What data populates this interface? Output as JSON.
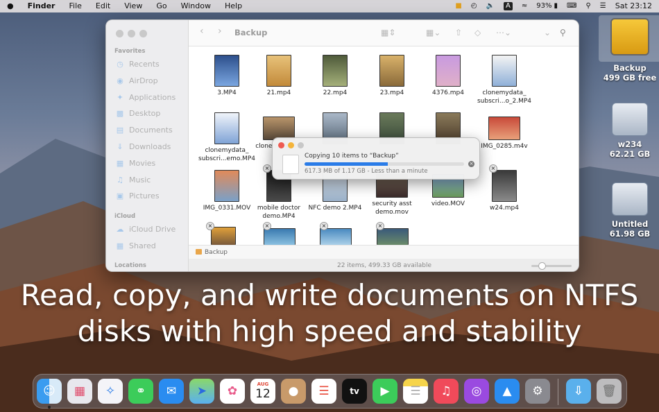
{
  "menubar": {
    "apple": "",
    "app": "Finder",
    "menus": [
      "File",
      "Edit",
      "View",
      "Go",
      "Window",
      "Help"
    ],
    "battery": "93%",
    "input_source": "A",
    "clock": "Sat 23:12"
  },
  "finder": {
    "title": "Backup",
    "sidebar": {
      "favorites_header": "Favorites",
      "favorites": [
        "Recents",
        "AirDrop",
        "Applications",
        "Desktop",
        "Documents",
        "Downloads",
        "Movies",
        "Music",
        "Pictures"
      ],
      "icloud_header": "iCloud",
      "icloud": [
        "iCloud Drive",
        "Shared"
      ],
      "locations_header": "Locations"
    },
    "files": [
      "3.MP4",
      "21.mp4",
      "22.mp4",
      "23.mp4",
      "4376.mp4",
      "clonemydata_ subscri...o_2.MP4",
      "clonemydata_ subscri...emo.MP4",
      "clonem sferdat",
      "",
      "",
      "",
      "IMG_0285.m4v",
      "IMG_0331.MOV",
      "mobile doctor demo.MP4",
      "NFC demo 2.MP4",
      "security asst demo.mov",
      "video.MOV",
      "w24.mp4"
    ],
    "pathbar": "Backup",
    "status": "22 items, 499.33 GB available"
  },
  "copy_dialog": {
    "title": "Copying 10 items to “Backup”",
    "detail": "617.3 MB of 1.17 GB - Less than a minute",
    "progress": 0.52
  },
  "desktop": {
    "disks": [
      {
        "name": "Backup",
        "size": "499 GB free"
      },
      {
        "name": "w234",
        "size": "62.21 GB"
      },
      {
        "name": "Untitled",
        "size": "61.98 GB"
      }
    ]
  },
  "headline": {
    "line1": "Read, copy, and write documents on NTFS",
    "line2": "disks with high speed and stability"
  },
  "dock": {
    "calendar_month": "AUG",
    "calendar_day": "12",
    "tv_label": "tv"
  },
  "colors": {
    "accent": "#2a7ce8",
    "folder": "#e9a64a",
    "backup_drive": "#f0b429"
  }
}
